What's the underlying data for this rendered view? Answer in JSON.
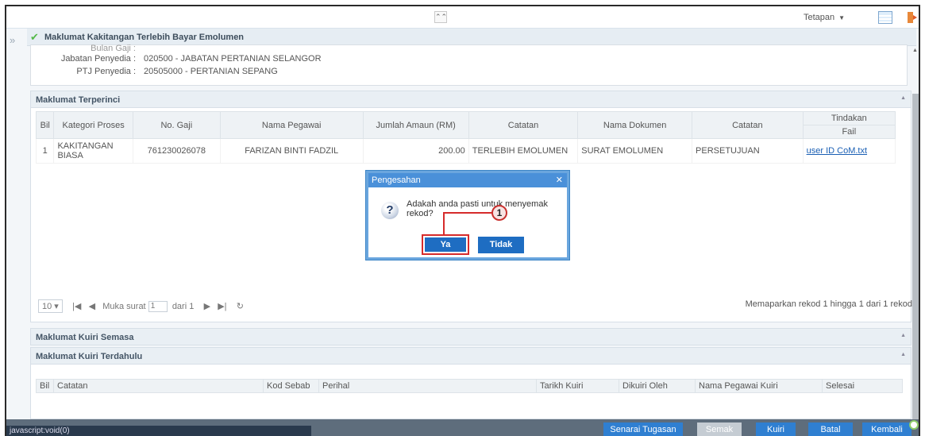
{
  "topbar": {
    "collapse_icon": "double-chevron-up-icon",
    "settings_label": "Tetapan"
  },
  "breadcrumb": {
    "title": "Maklumat Kakitangan Terlebih Bayar Emolumen"
  },
  "info": {
    "partial_label": "Bulan Gaji :",
    "rows": [
      {
        "label": "Jabatan Penyedia :",
        "value": "020500 - JABATAN PERTANIAN SELANGOR"
      },
      {
        "label": "PTJ Penyedia :",
        "value": "20505000 - PERTANIAN SEPANG"
      }
    ]
  },
  "detail": {
    "heading": "Maklumat Terperinci",
    "columns": {
      "bil": "Bil",
      "kategori": "Kategori Proses",
      "nogaji": "No. Gaji",
      "nama": "Nama Pegawai",
      "jumlah": "Jumlah Amaun (RM)",
      "catatan": "Catatan",
      "dokumen": "Nama Dokumen",
      "catatan2": "Catatan",
      "tindakan": "Tindakan",
      "fail": "Fail"
    },
    "row": {
      "bil": "1",
      "kategori": "KAKITANGAN BIASA",
      "nogaji": "761230026078",
      "nama": "FARIZAN BINTI FADZIL",
      "jumlah": "200.00",
      "catatan": "TERLEBIH EMOLUMEN",
      "dokumen": "SURAT EMOLUMEN",
      "catatan2": "PERSETUJUAN",
      "fail": "user ID CoM.txt"
    },
    "pager": {
      "page_size": "10",
      "page_label": "Muka surat",
      "page_value": "1",
      "of_label": "dari 1",
      "info": "Memaparkan rekod 1 hingga 1 dari 1 rekod"
    }
  },
  "dialog": {
    "title": "Pengesahan",
    "message": "Adakah anda pasti untuk menyemak rekod?",
    "yes_label": "Ya",
    "no_label": "Tidak",
    "callout_number": "1"
  },
  "kuiri_semasa": {
    "heading": "Maklumat Kuiri Semasa"
  },
  "kuiri_terdahulu": {
    "heading": "Maklumat Kuiri Terdahulu",
    "columns": [
      "Bil",
      "Catatan",
      "Kod Sebab",
      "Perihal",
      "Tarikh Kuiri",
      "Dikuiri Oleh",
      "Nama Pegawai Kuiri",
      "Selesai"
    ]
  },
  "status_bar": {
    "url": "javascript:void(0)"
  },
  "actions": {
    "senarai": "Senarai Tugasan",
    "semak": "Semak",
    "kuiri": "Kuiri",
    "batal": "Batal",
    "kembali": "Kembali"
  }
}
